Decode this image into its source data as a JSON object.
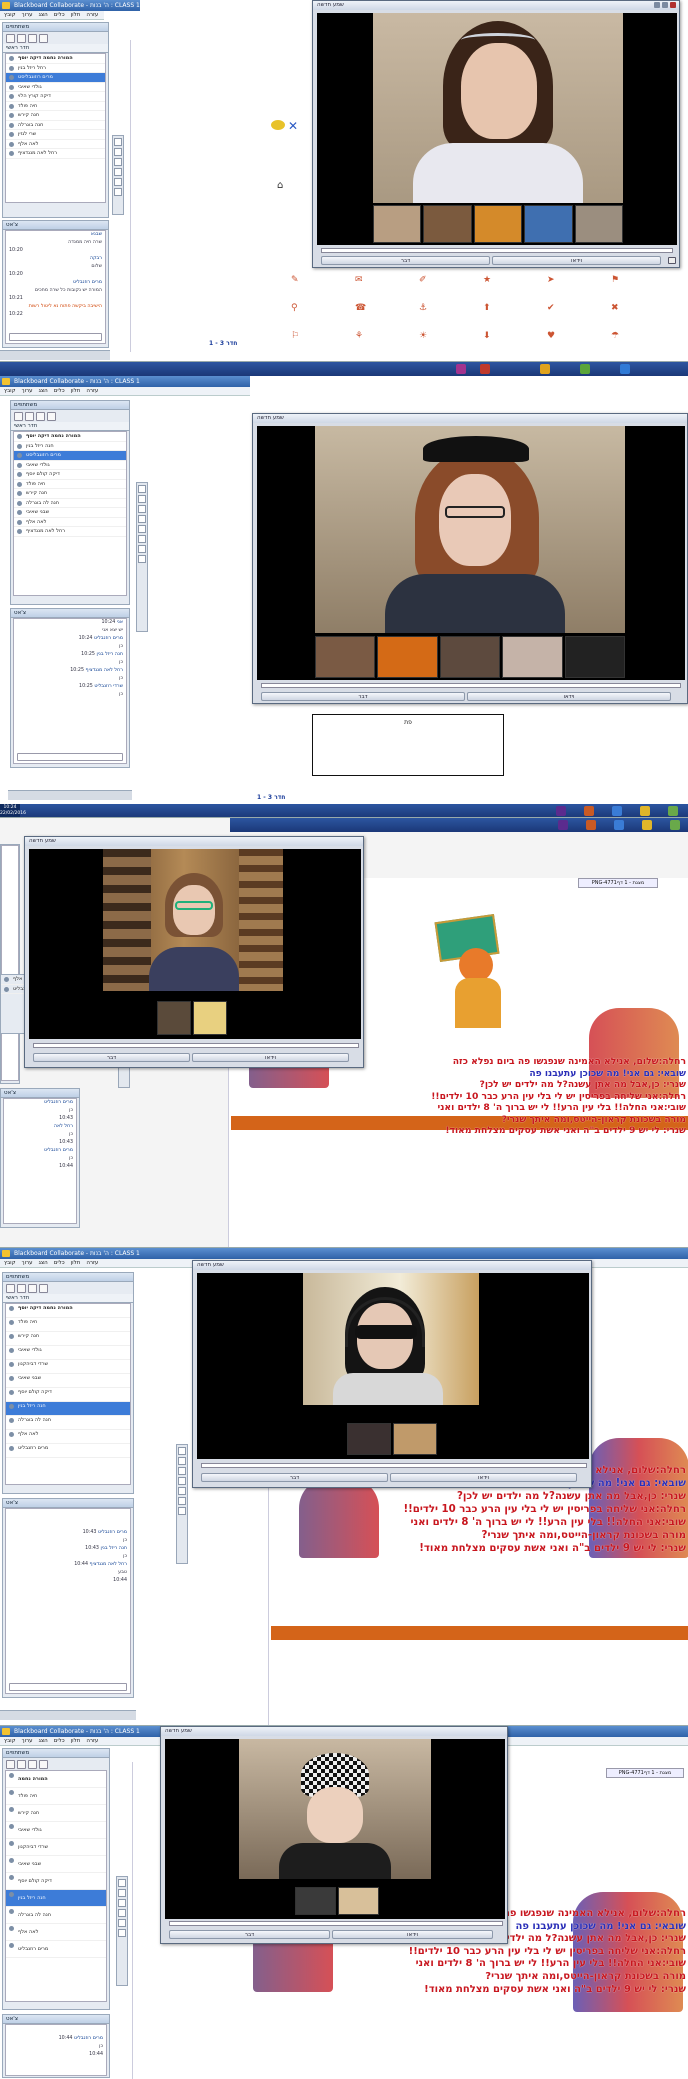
{
  "app": {
    "title": "Blackboard Collaborate - ה' בנות : CLASS 1",
    "menu": [
      "עזרה",
      "חלון",
      "כלים",
      "הצג",
      "ערוך",
      "קובץ"
    ]
  },
  "panels": {
    "participants_title": "משתתפים",
    "chat_title": "צ'אט",
    "main_room": "חדר ראשי",
    "video_window_title": "שמע חדשה"
  },
  "video_buttons": {
    "talk": "דבר",
    "video": "וידאו"
  },
  "whiteboard": {
    "page_indicator": "חדר 3 - 1",
    "box_label": "פת",
    "pdf_tab": "PNG-4771מצגת - 1 דף",
    "lesson_lines": [
      "רחלה:שלום, אנילא האמינה שנפגשו פה ביום נפלא כזה",
      "שובאי: גם אני! מה שכוכן עתעבנו פה",
      "שנרי: כן,אבל מה אתן עשנה?ל מה ילדים יש לכן?",
      "רחלה:אני שליחה בפריסין יש לי בלי עין הרע כבר 10 ילדים!!",
      "שובי:אני החלה!! בלי עין הרע!! לי יש ברוך ה' 8 ילדים ואני",
      "מורה בשכונת קראון-הייטס,ומה איתך שנרי?",
      "שנרי: לי יש 9 ילדים ב\"ה ואני אשת עסקים מצלחת מאוד!"
    ]
  },
  "shots": [
    {
      "participants": [
        "המורה נחמה דיקה יוסף",
        "רחל ריזל בנין",
        "מרים רוזוגבליסט",
        "גולדי שאיבי",
        "דיקה קורץ הלוי",
        "חיה פולד",
        "חנה קירש",
        "חנה בוגרלה",
        "שרי לגזין",
        "לאה אלף",
        "רחל לאה מנגדציף"
      ],
      "chat": [
        {
          "who": "שבנא",
          "text": "שרה חיה ממנדה"
        },
        {
          "who": "רבקה",
          "text": "שלום"
        },
        {
          "who": "מרים רוזנבליט",
          "text": "המורה יש נקובות כל שרה מחכים"
        }
      ],
      "chat_warn": "הישיבה ביקשה פתוח נא ליטול רשות",
      "times": [
        "10:20",
        "10:20",
        "10:21",
        "10:22"
      ]
    },
    {
      "participants": [
        "המורה נחמה דיקה יוסף",
        "חנה ריזל בנין",
        "מרים רוזוגבליסט",
        "גולדי שאיבי",
        "דיקה קולם יוסף",
        "חיה פולד",
        "חנה קירש",
        "חנה לה בוגרלה",
        "שבני שאיבי",
        "לאה אלף",
        "רחל לאה מנגדציף"
      ],
      "chat": [
        {
          "who": "אני",
          "text": "יש יצא אני"
        },
        {
          "who": "מרים רוזנבליט",
          "text": "כן"
        },
        {
          "who": "חנה ריזל בנין",
          "text": "כן"
        },
        {
          "who": "רחל לאה מנגדציף",
          "text": "כן"
        },
        {
          "who": "שרדי רוזנבליט",
          "text": "כן"
        }
      ],
      "times": [
        "10:24",
        "10:24",
        "10:25",
        "10:25",
        "10:25",
        "10:26"
      ],
      "clock": "10:24",
      "date": "22/02/2016"
    },
    {
      "participants": [
        "לאה אלף",
        "מרים רוזנבליט"
      ],
      "chat": [
        {
          "who": "מרים רוזנבליט",
          "text": "כן"
        },
        {
          "who": "רחל לאה",
          "text": "כן"
        },
        {
          "who": "מרים רוזנבליט",
          "text": "כן"
        }
      ],
      "times": [
        "10:43",
        "10:43",
        "10:44"
      ]
    },
    {
      "participants": [
        "המורה נחמה דיקה יוסף",
        "חיה פולד",
        "חנה קירש",
        "גולדי שאיבי",
        "שרדי דביהקנון",
        "שבני שאיבי",
        "דיקה קולם יוסף",
        "חנה ריזל בנין",
        "חנה לה בוגרלה",
        "לאה אלף",
        "מרים רוזנבליט"
      ],
      "chat": [
        {
          "who": "מרים רוזנבליט",
          "text": "כן"
        },
        {
          "who": "חנה ריזל בנין",
          "text": "כן"
        },
        {
          "who": "רחל לאה מנגדציף",
          "text": "טבע"
        }
      ],
      "times": [
        "10:43",
        "10:43",
        "10:44",
        "10:44"
      ]
    },
    {
      "participants": [
        "המורה נחמה",
        "חיה פולד",
        "חנה קירש",
        "גולדי שאיבי",
        "שרדי דביהקנון",
        "שבני שאיבי",
        "דיקה קולם יוסף",
        "חנה ריזל בנין",
        "חנה לה בוגרלה",
        "לאה אלף",
        "מרים רוזנבליט"
      ],
      "chat": [
        {
          "who": "מרים רוזנבליט",
          "text": "כן"
        }
      ],
      "times": [
        "10:44",
        "10:44"
      ]
    }
  ],
  "colors": {
    "accent": "#3d7cd8",
    "title": "#2f62a8",
    "red_text": "#c8161e",
    "orange_bar": "#d46419"
  }
}
